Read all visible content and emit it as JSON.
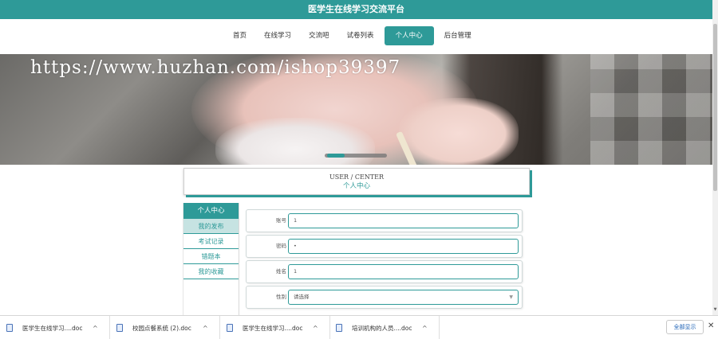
{
  "header": {
    "title": "医学生在线学习交流平台",
    "bg_color": "#2e9a98"
  },
  "nav": {
    "items": [
      {
        "label": "首页"
      },
      {
        "label": "在线学习"
      },
      {
        "label": "交流吧"
      },
      {
        "label": "试卷列表"
      },
      {
        "label": "个人中心",
        "active": true
      },
      {
        "label": "后台管理"
      }
    ]
  },
  "banner": {
    "watermark": "https://www.huzhan.com/ishop39397"
  },
  "center": {
    "title_en": "USER / CENTER",
    "title_cn": "个人中心"
  },
  "sidebar": {
    "head": "个人中心",
    "items": [
      {
        "label": "我的发布",
        "selected": true
      },
      {
        "label": "考试记录"
      },
      {
        "label": "错题本"
      },
      {
        "label": "我的收藏"
      }
    ]
  },
  "form": {
    "fields": [
      {
        "label": "账号",
        "value": "1"
      },
      {
        "label": "密码",
        "value": "•"
      },
      {
        "label": "姓名",
        "value": "1"
      },
      {
        "label": "性别",
        "value": "请选择"
      }
    ]
  },
  "downloads": {
    "items": [
      {
        "name": "医学生在线学习....doc"
      },
      {
        "name": "校园点餐系统 (2).doc"
      },
      {
        "name": "医学生在线学习....doc"
      },
      {
        "name": "培训机构的人员....doc"
      }
    ],
    "show_all": "全部显示"
  }
}
